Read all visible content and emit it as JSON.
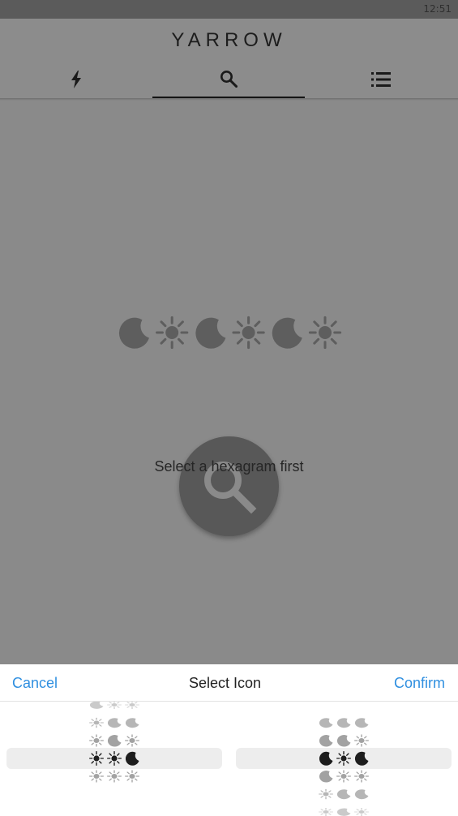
{
  "status_bar": {
    "time": "12:51"
  },
  "app_bar": {
    "title": "YARROW",
    "tabs": [
      {
        "name": "flash",
        "icon": "lightning-icon",
        "active": false
      },
      {
        "name": "search",
        "icon": "search-icon",
        "active": true
      },
      {
        "name": "list",
        "icon": "list-icon",
        "active": false
      }
    ]
  },
  "main": {
    "hexagram_icons": [
      "moon-icon",
      "sun-icon",
      "moon-icon",
      "sun-icon",
      "moon-icon",
      "sun-icon"
    ],
    "center_icon": "search-icon",
    "empty_message": "Select a hexagram first"
  },
  "sheet": {
    "cancel_label": "Cancel",
    "title": "Select Icon",
    "confirm_label": "Confirm",
    "columns": [
      {
        "name": "left",
        "rows": [
          [
            "moon-icon",
            "sun-icon",
            "sun-icon"
          ],
          [
            "sun-icon",
            "moon-icon",
            "moon-icon"
          ],
          [
            "sun-icon",
            "moon-icon",
            "sun-icon"
          ],
          [
            "sun-icon",
            "sun-icon",
            "moon-icon"
          ],
          [
            "sun-icon",
            "sun-icon",
            "sun-icon"
          ]
        ],
        "selected_row": 3
      },
      {
        "name": "right",
        "rows": [
          [
            "moon-icon",
            "moon-icon",
            "moon-icon"
          ],
          [
            "moon-icon",
            "moon-icon",
            "sun-icon"
          ],
          [
            "moon-icon",
            "sun-icon",
            "moon-icon"
          ],
          [
            "moon-icon",
            "sun-icon",
            "sun-icon"
          ],
          [
            "sun-icon",
            "moon-icon",
            "moon-icon"
          ],
          [
            "sun-icon",
            "moon-icon",
            "sun-icon"
          ]
        ],
        "selected_row": 2
      }
    ]
  },
  "colors": {
    "accent": "#2f8fe0",
    "scrim": "#8a8a8a",
    "icon_dim": "#5e5e5e",
    "icon_dark": "#1d1d1d"
  }
}
